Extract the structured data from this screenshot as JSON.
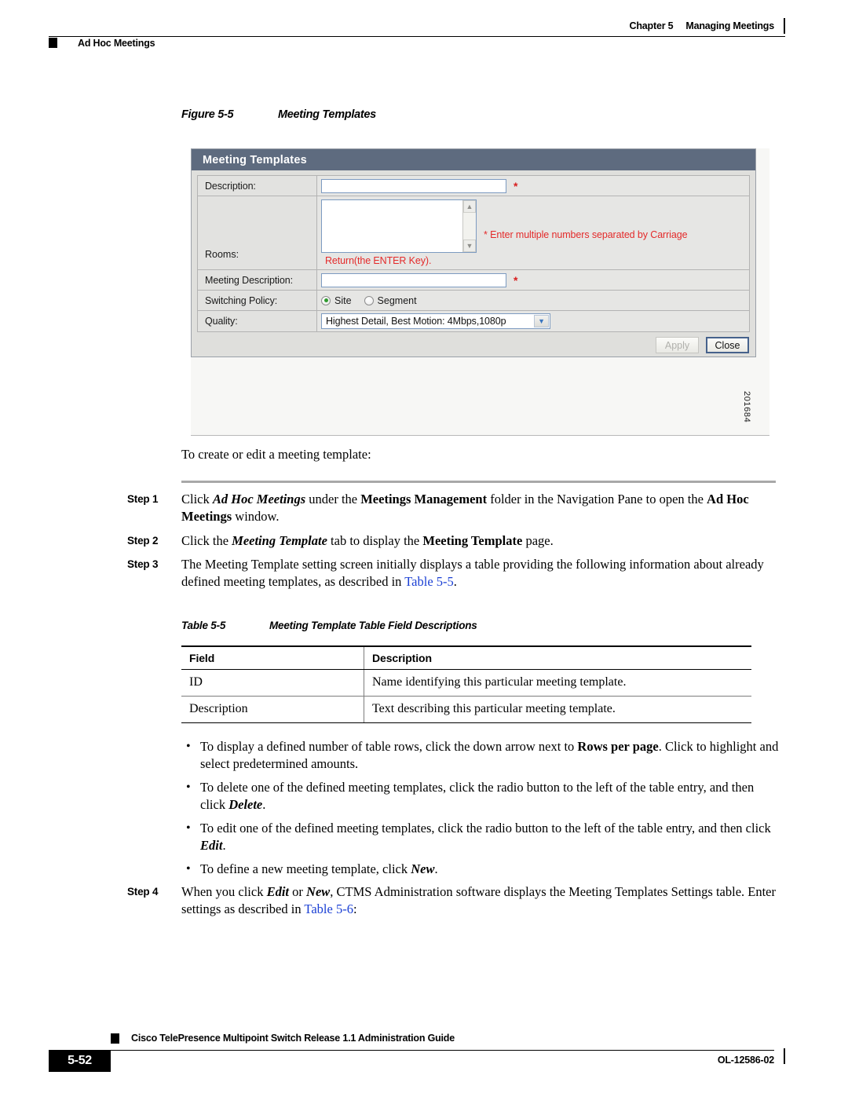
{
  "header": {
    "chapter": "Chapter 5",
    "chapter_title": "Managing Meetings",
    "section_label": "Ad Hoc Meetings"
  },
  "figure": {
    "caption_number": "Figure 5-5",
    "caption_title": "Meeting Templates",
    "figure_id": "201684",
    "window": {
      "title": "Meeting Templates",
      "fields": {
        "description_label": "Description:",
        "description_value": "",
        "rooms_label": "Rooms:",
        "rooms_value": "",
        "rooms_note_line1": "* Enter multiple numbers separated by Carriage",
        "rooms_note_line2": "Return(the ENTER Key).",
        "meeting_description_label": "Meeting Description:",
        "meeting_description_value": "",
        "switching_policy_label": "Switching Policy:",
        "switching_option_site": "Site",
        "switching_option_segment": "Segment",
        "quality_label": "Quality:",
        "quality_value": "Highest Detail, Best Motion: 4Mbps,1080p"
      },
      "required_marker": "*",
      "buttons": {
        "apply": "Apply",
        "close": "Close"
      },
      "colors": {
        "titlebar": "#5e6b7f",
        "note_red": "#e42a2a",
        "input_border": "#7d9bc1"
      }
    }
  },
  "intro": "To create or edit a meeting template:",
  "steps": [
    {
      "num": "Step 1",
      "parts": [
        {
          "t": "Click ",
          "s": "n"
        },
        {
          "t": "Ad Hoc Meetings",
          "s": "bi"
        },
        {
          "t": " under the ",
          "s": "n"
        },
        {
          "t": "Meetings Management",
          "s": "b"
        },
        {
          "t": " folder in the Navigation Pane to open the ",
          "s": "n"
        },
        {
          "t": "Ad Hoc Meetings",
          "s": "b"
        },
        {
          "t": " window.",
          "s": "n"
        }
      ]
    },
    {
      "num": "Step 2",
      "parts": [
        {
          "t": "Click the ",
          "s": "n"
        },
        {
          "t": "Meeting Template",
          "s": "bi"
        },
        {
          "t": " tab to display the ",
          "s": "n"
        },
        {
          "t": "Meeting Template",
          "s": "b"
        },
        {
          "t": " page.",
          "s": "n"
        }
      ]
    },
    {
      "num": "Step 3",
      "parts": [
        {
          "t": "The Meeting Template setting screen initially displays a table providing the following information about already defined meeting templates, as described in ",
          "s": "n"
        },
        {
          "t": "Table 5-5",
          "s": "x"
        },
        {
          "t": ".",
          "s": "n"
        }
      ]
    },
    {
      "num": "Step 4",
      "parts": [
        {
          "t": "When you click ",
          "s": "n"
        },
        {
          "t": "Edit",
          "s": "bi"
        },
        {
          "t": " or ",
          "s": "n"
        },
        {
          "t": "New",
          "s": "bi"
        },
        {
          "t": ", CTMS Administration software displays the Meeting Templates Settings table. Enter settings as described in ",
          "s": "n"
        },
        {
          "t": "Table 5-6",
          "s": "x"
        },
        {
          "t": ":",
          "s": "n"
        }
      ]
    }
  ],
  "table": {
    "caption_number": "Table 5-5",
    "caption_title": "Meeting Template Table Field Descriptions",
    "columns": [
      "Field",
      "Description"
    ],
    "rows": [
      [
        "ID",
        "Name identifying this particular meeting template."
      ],
      [
        "Description",
        "Text describing this particular meeting template."
      ]
    ]
  },
  "bullets": [
    {
      "dot": "•",
      "parts": [
        {
          "t": "To display a defined number of table rows, click the down arrow next to ",
          "s": "n"
        },
        {
          "t": "Rows per page",
          "s": "b"
        },
        {
          "t": ". Click to highlight and select predetermined amounts.",
          "s": "n"
        }
      ]
    },
    {
      "dot": "•",
      "parts": [
        {
          "t": "To delete one of the defined meeting templates, click the radio button to the left of the table entry, and then click ",
          "s": "n"
        },
        {
          "t": "Delete",
          "s": "bi"
        },
        {
          "t": ".",
          "s": "n"
        }
      ]
    },
    {
      "dot": "•",
      "parts": [
        {
          "t": "To edit one of the defined meeting templates, click the radio button to the left of the table entry, and then click ",
          "s": "n"
        },
        {
          "t": "Edit",
          "s": "bi"
        },
        {
          "t": ".",
          "s": "n"
        }
      ]
    },
    {
      "dot": "•",
      "parts": [
        {
          "t": "To define a new meeting template, click ",
          "s": "n"
        },
        {
          "t": "New",
          "s": "bi"
        },
        {
          "t": ".",
          "s": "n"
        }
      ]
    }
  ],
  "footer": {
    "guide_title": "Cisco TelePresence Multipoint Switch Release 1.1 Administration Guide",
    "page_number": "5-52",
    "doc_number": "OL-12586-02"
  }
}
